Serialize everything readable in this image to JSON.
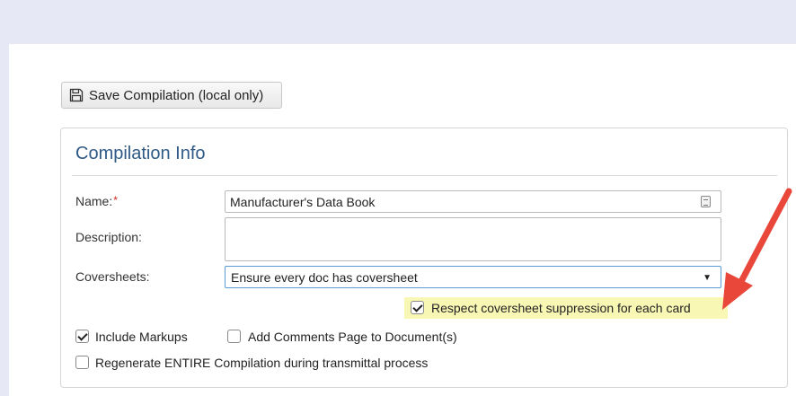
{
  "toolbar": {
    "save_label": "Save Compilation (local only)",
    "save_icon": "floppy-disk-icon"
  },
  "compilation_info": {
    "title": "Compilation Info",
    "name_label": "Name:",
    "name_required_marker": "*",
    "name_value": "Manufacturer's Data Book",
    "description_label": "Description:",
    "description_value": "",
    "coversheets_label": "Coversheets:",
    "coversheets_selected": "Ensure every doc has coversheet",
    "respect_suppression_label": "Respect coversheet suppression for each card",
    "respect_suppression_checked": true,
    "include_markups_label": "Include Markups",
    "include_markups_checked": true,
    "add_comments_label": "Add Comments Page to Document(s)",
    "add_comments_checked": false,
    "regenerate_label": "Regenerate ENTIRE Compilation during transmittal process",
    "regenerate_checked": false
  },
  "colors": {
    "header_band": "#e6e9f5",
    "panel_title": "#2f5a86",
    "highlight": "#f8f7b4",
    "annotation_arrow": "#e8473a",
    "required_marker": "#d9251c"
  }
}
